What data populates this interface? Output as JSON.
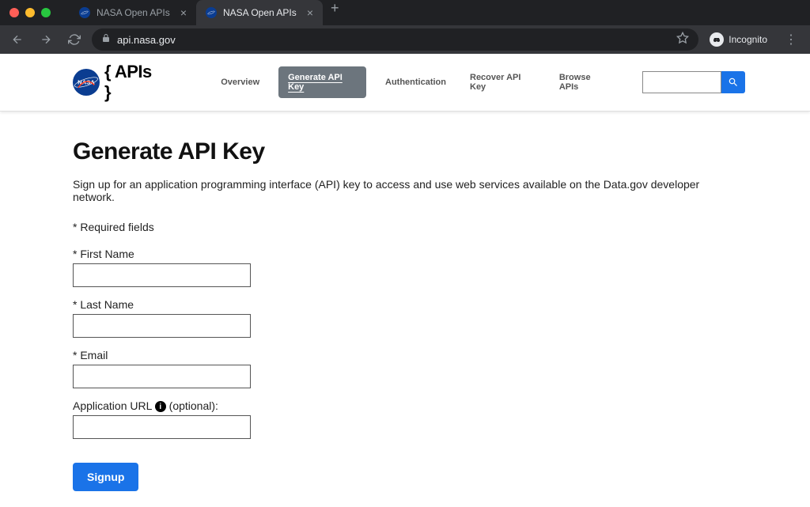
{
  "browser": {
    "tabs": [
      {
        "title": "NASA Open APIs",
        "active": false
      },
      {
        "title": "NASA Open APIs",
        "active": true
      }
    ],
    "url": "api.nasa.gov",
    "incognito_label": "Incognito"
  },
  "header": {
    "logo_text": "{ APIs }",
    "nav": {
      "overview": "Overview",
      "generate": "Generate API Key",
      "auth": "Authentication",
      "recover": "Recover API Key",
      "browse": "Browse APIs"
    }
  },
  "main": {
    "title": "Generate API Key",
    "description": "Sign up for an application programming interface (API) key to access and use web services available on the Data.gov developer network.",
    "required_note": "* Required fields",
    "fields": {
      "first_name": {
        "label": "* First Name",
        "value": ""
      },
      "last_name": {
        "label": "* Last Name",
        "value": ""
      },
      "email": {
        "label": "* Email",
        "value": ""
      },
      "app_url": {
        "label_pre": "Application URL",
        "label_post": " (optional):",
        "value": ""
      }
    },
    "signup_label": "Signup"
  }
}
